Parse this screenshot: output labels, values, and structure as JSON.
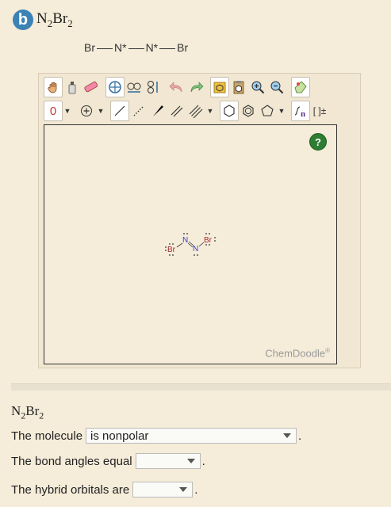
{
  "part": {
    "badge": "b",
    "formula_main": "N",
    "formula_sub1": "2",
    "formula_mid": "Br",
    "formula_sub2": "2"
  },
  "skeletal": {
    "atom1": "Br",
    "atom2": "N*",
    "atom3": "N*",
    "atom4": "Br"
  },
  "chemdoodle": {
    "help_label": "?",
    "watermark": "ChemDoodle",
    "watermark_reg": "®",
    "charge_label": "0",
    "bracket_label": "[ ]±",
    "molecule_labels": [
      "Br",
      "N",
      "N",
      "Br"
    ]
  },
  "questions": {
    "formula_main": "N",
    "formula_sub1": "2",
    "formula_mid": "Br",
    "formula_sub2": "2",
    "q1_label": "The molecule",
    "q1_value": "is nonpolar",
    "q2_label": "The bond angles equal",
    "q2_value": "",
    "q3_label": "The hybrid orbitals are",
    "q3_value": ""
  },
  "colors": {
    "badge": "#3b82b5",
    "help": "#2e7d32",
    "bromine": "#a52a2a",
    "nitrogen": "#3b3bcc"
  }
}
